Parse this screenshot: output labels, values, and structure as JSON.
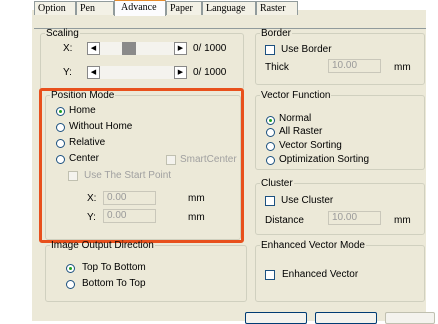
{
  "tabs": [
    "Option",
    "Pen",
    "Advance",
    "Paper",
    "Language",
    "Raster"
  ],
  "scaling": {
    "legend": "Scaling",
    "x_label": "X:",
    "y_label": "Y:",
    "x_value": "0/ 1000",
    "y_value": "0/ 1000"
  },
  "border": {
    "legend": "Border",
    "use_border": "Use Border",
    "thick_label": "Thick",
    "thick_value": "10.00",
    "unit": "mm"
  },
  "position_mode": {
    "legend": "Position Mode",
    "options": [
      "Home",
      "Without Home",
      "Relative",
      "Center"
    ],
    "selected": "Home",
    "smart_center": "SmartCenter",
    "use_start_point": "Use The Start Point",
    "x_label": "X:",
    "y_label": "Y:",
    "x_value": "0.00",
    "y_value": "0.00",
    "unit": "mm"
  },
  "vector_function": {
    "legend": "Vector Function",
    "options": [
      "Normal",
      "All Raster",
      "Vector Sorting",
      "Optimization Sorting"
    ],
    "selected": "Normal"
  },
  "cluster": {
    "legend": "Cluster",
    "use_cluster": "Use Cluster",
    "distance_label": "Distance",
    "distance_value": "10.00",
    "unit": "mm"
  },
  "image_output": {
    "legend": "Image Output Direction",
    "options": [
      "Top To Bottom",
      "Bottom To Top"
    ],
    "selected": "Top To Bottom"
  },
  "enhanced": {
    "legend": "Enhanced Vector Mode",
    "enhanced_vector": "Enhanced Vector"
  },
  "highlight_color": "#e8501c"
}
